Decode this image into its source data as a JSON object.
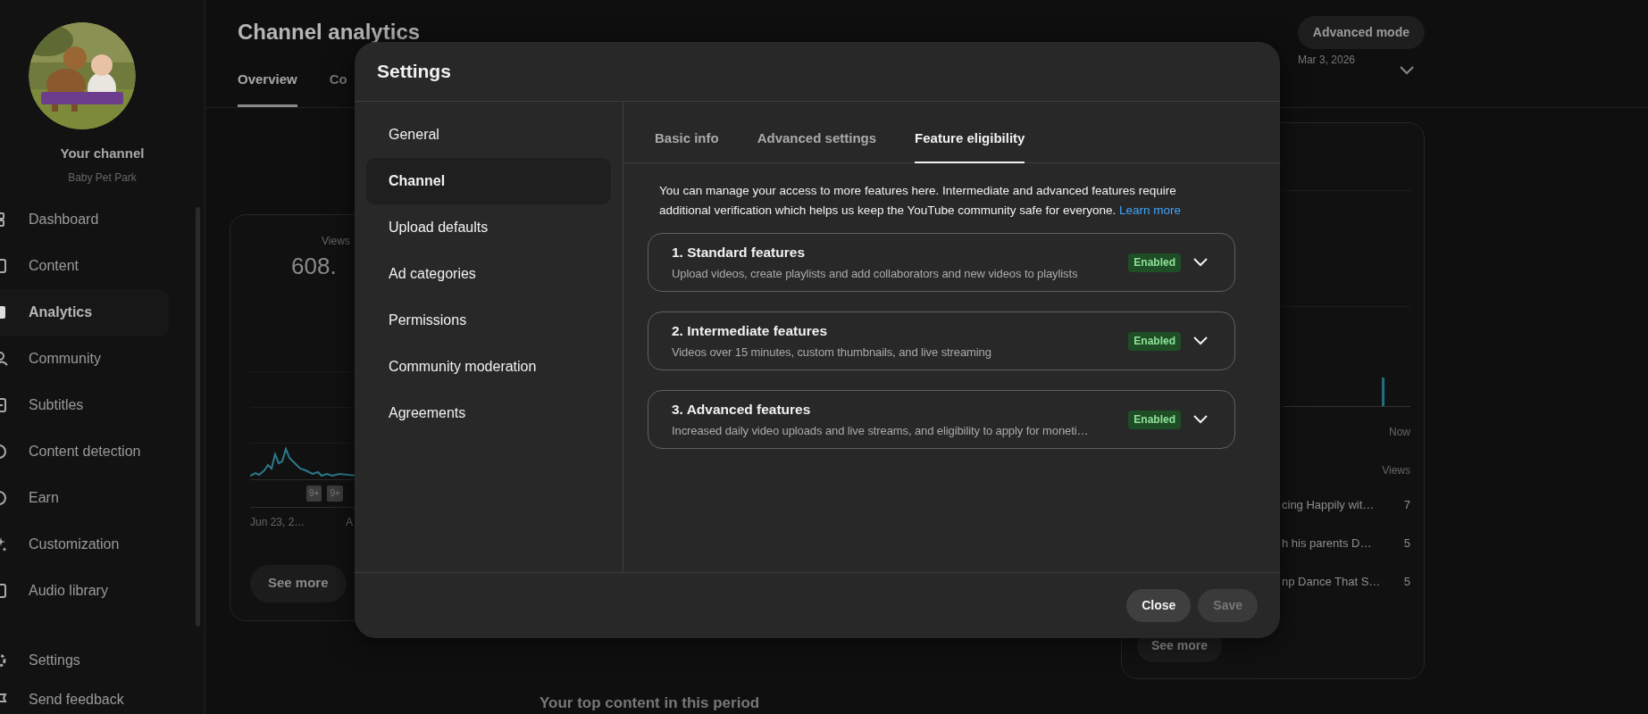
{
  "sidebar": {
    "channel_label": "Your channel",
    "channel_name": "Baby Pet Park",
    "items": [
      {
        "label": "Dashboard",
        "selected": false
      },
      {
        "label": "Content",
        "selected": false
      },
      {
        "label": "Analytics",
        "selected": true
      },
      {
        "label": "Community",
        "selected": false
      },
      {
        "label": "Subtitles",
        "selected": false
      },
      {
        "label": "Content detection",
        "selected": false
      },
      {
        "label": "Earn",
        "selected": false
      },
      {
        "label": "Customization",
        "selected": false
      },
      {
        "label": "Audio library",
        "selected": false
      }
    ],
    "footer_items": [
      {
        "label": "Settings"
      },
      {
        "label": "Send feedback"
      }
    ]
  },
  "page": {
    "title": "Channel analytics",
    "advanced_mode_button": "Advanced mode",
    "tabs": [
      {
        "label": "Overview",
        "selected": true
      },
      {
        "label": "Co",
        "selected": false
      }
    ],
    "date_range": "Mar 3, 2026",
    "views_card": {
      "label": "Views",
      "value": "608.",
      "badges": [
        "9+",
        "9+"
      ],
      "x_labels": [
        "Jun 23, 2…",
        "A"
      ],
      "see_more": "See more"
    },
    "side_card": {
      "x_label": "Now",
      "column_header": "Views",
      "rows": [
        {
          "title": "cing Happily wit…",
          "views": "7"
        },
        {
          "title": "h his parents D…",
          "views": "5"
        },
        {
          "title": "np Dance That S…",
          "views": "5"
        }
      ],
      "see_more": "See more"
    },
    "section_heading": "Your top content in this period"
  },
  "dialog": {
    "title": "Settings",
    "nav": [
      {
        "label": "General",
        "selected": false
      },
      {
        "label": "Channel",
        "selected": true
      },
      {
        "label": "Upload defaults",
        "selected": false
      },
      {
        "label": "Ad categories",
        "selected": false
      },
      {
        "label": "Permissions",
        "selected": false
      },
      {
        "label": "Community moderation",
        "selected": false
      },
      {
        "label": "Agreements",
        "selected": false
      }
    ],
    "tabs": [
      {
        "label": "Basic info",
        "selected": false
      },
      {
        "label": "Advanced settings",
        "selected": false
      },
      {
        "label": "Feature eligibility",
        "selected": true
      }
    ],
    "intro": "You can manage your access to more features here. Intermediate and advanced features require additional verification which helps us keep the YouTube community safe for everyone.",
    "learn_more": "Learn more",
    "features": [
      {
        "title": "1. Standard features",
        "description": "Upload videos, create playlists and add collaborators and new videos to playlists",
        "status": "Enabled",
        "expanded": false
      },
      {
        "title": "2. Intermediate features",
        "description": "Videos over 15 minutes, custom thumbnails, and live streaming",
        "status": "Enabled",
        "expanded": false
      },
      {
        "title": "3. Advanced features",
        "description": "Increased daily video uploads and live streams, and eligibility to apply for moneti…",
        "status": "Enabled",
        "expanded": false
      }
    ],
    "buttons": [
      {
        "label": "Close",
        "disabled": false
      },
      {
        "label": "Save",
        "disabled": true
      }
    ]
  }
}
